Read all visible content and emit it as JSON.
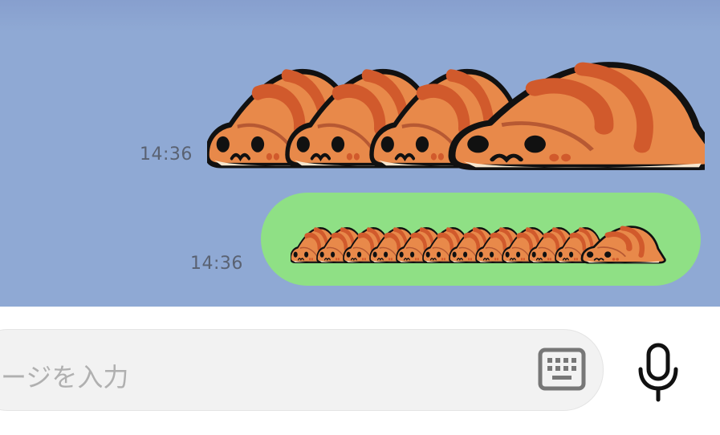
{
  "messages": [
    {
      "time": "14:36",
      "type": "sticker",
      "sticker_name": "snake-sticker-large"
    },
    {
      "time": "14:36",
      "type": "sticker-in-bubble",
      "sticker_name": "snake-sticker-small-row"
    }
  ],
  "input": {
    "placeholder": "ージを入力"
  },
  "icons": {
    "keyboard": "keyboard-icon",
    "mic": "microphone-icon"
  },
  "colors": {
    "chat_background": "#8fa9d4",
    "outgoing_bubble": "#8fe085",
    "snake_orange": "#e8894a",
    "snake_stripe": "#d15a2c",
    "snake_belly": "#f7e7cf"
  }
}
